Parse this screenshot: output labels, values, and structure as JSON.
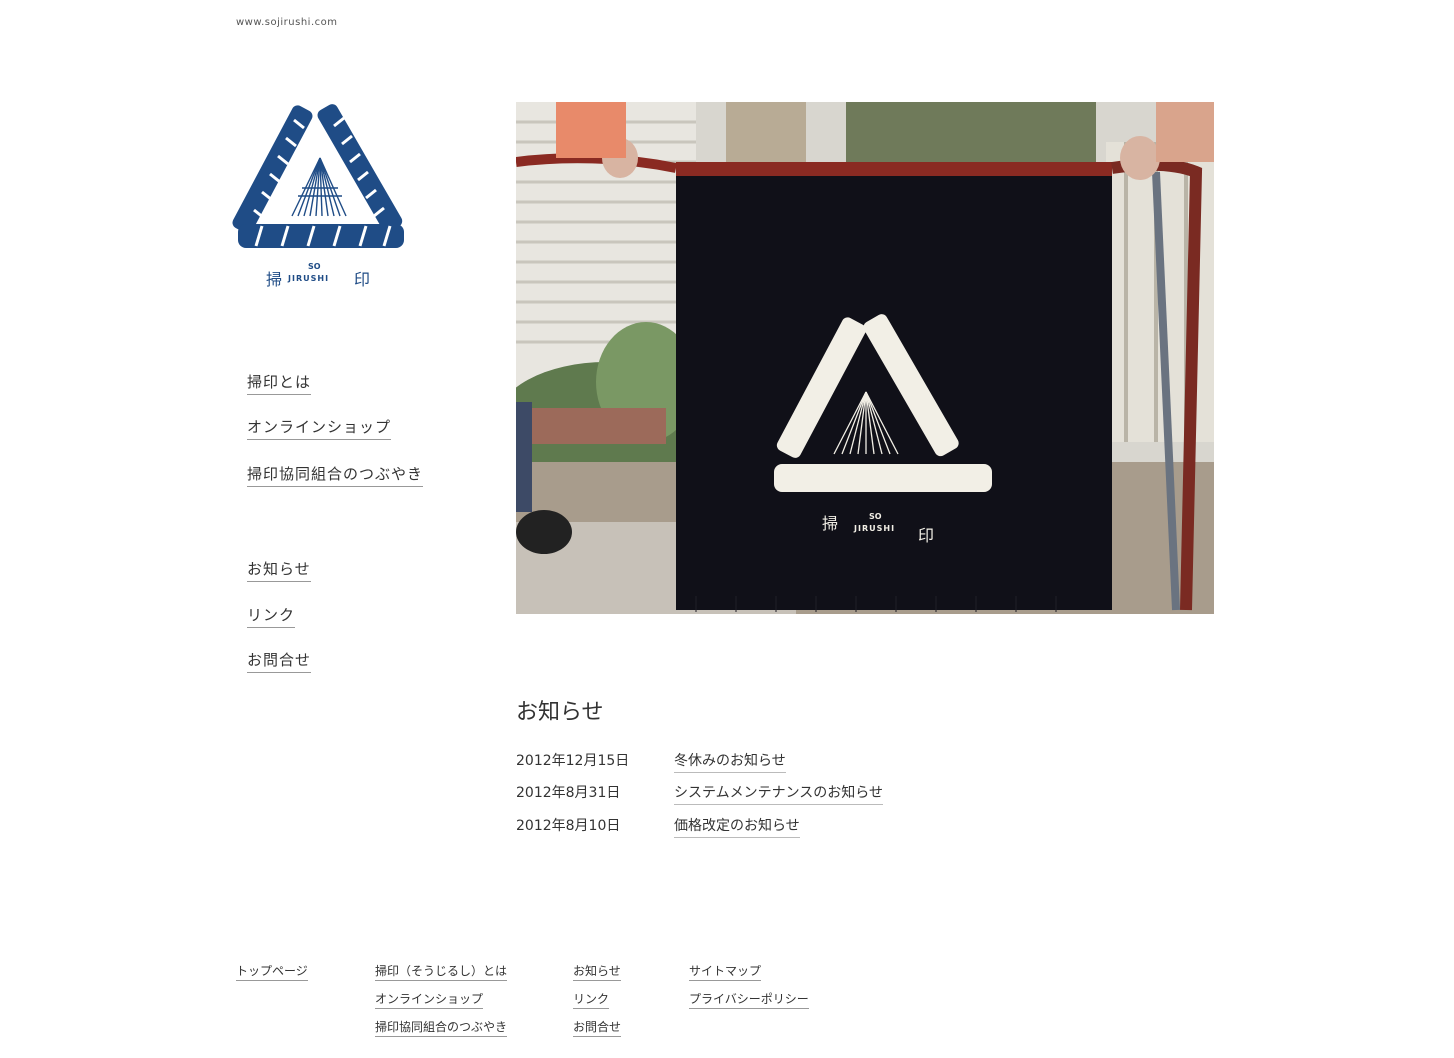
{
  "site": {
    "domain": "www.sojirushi.com",
    "logo_kanji_left": "掃",
    "logo_kanji_right": "印",
    "logo_small_top": "SO",
    "logo_small_bottom": "JIRUSHI"
  },
  "nav_primary": [
    {
      "label": "掃印とは"
    },
    {
      "label": "オンラインショップ"
    },
    {
      "label": "掃印協同組合のつぶやき"
    }
  ],
  "nav_secondary": [
    {
      "label": "お知らせ"
    },
    {
      "label": "リンク"
    },
    {
      "label": "お問合せ"
    }
  ],
  "hero": {
    "kanji_left": "掃",
    "kanji_right": "印",
    "small_top": "SO",
    "small_bottom": "JIRUSHI"
  },
  "news": {
    "title": "お知らせ",
    "items": [
      {
        "date": "2012年12月15日",
        "title": "冬休みのお知らせ"
      },
      {
        "date": "2012年8月31日",
        "title": "システムメンテナンスのお知らせ"
      },
      {
        "date": "2012年8月10日",
        "title": "価格改定のお知らせ"
      }
    ]
  },
  "footer": {
    "col1": [
      "トップページ"
    ],
    "col2": [
      "掃印（そうじるし）とは",
      "オンラインショップ",
      "掃印協同組合のつぶやき"
    ],
    "col3": [
      "お知らせ",
      "リンク",
      "お問合せ"
    ],
    "col4": [
      "サイトマップ",
      "プライバシーポリシー"
    ]
  },
  "colors": {
    "logo_blue": "#1f4c86",
    "noren_black": "#101018",
    "noren_red": "#8a2a22"
  }
}
